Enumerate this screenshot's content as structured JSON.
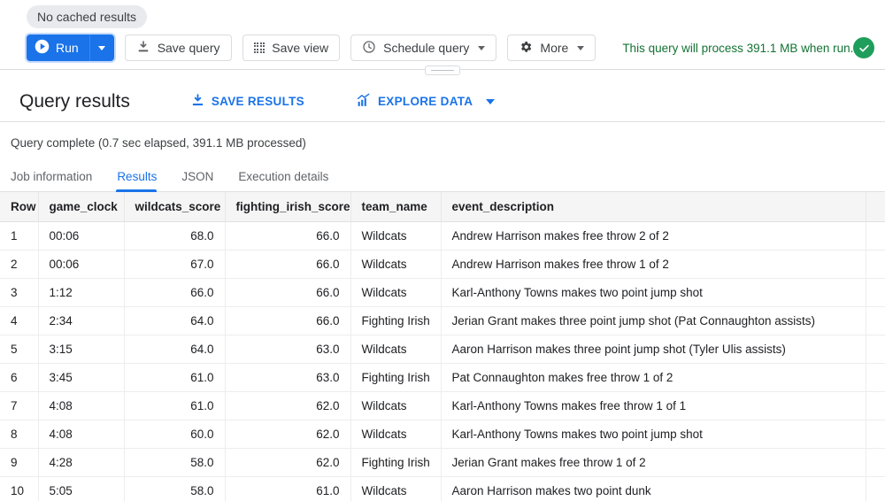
{
  "cache_chip": {
    "label": "No cached results"
  },
  "toolbar": {
    "run_label": "Run",
    "save_query_label": "Save query",
    "save_view_label": "Save view",
    "schedule_query_label": "Schedule query",
    "more_label": "More",
    "process_message": "This query will process 391.1 MB when run.",
    "valid_color": "#1e9e5a",
    "accent_color": "#1a73e8",
    "process_color": "#137333"
  },
  "results_header": {
    "title": "Query results",
    "save_results_label": "SAVE RESULTS",
    "explore_data_label": "EXPLORE DATA"
  },
  "status": {
    "text": "Query complete (0.7 sec elapsed, 391.1 MB processed)"
  },
  "tabs": [
    {
      "label": "Job information",
      "active": false
    },
    {
      "label": "Results",
      "active": true
    },
    {
      "label": "JSON",
      "active": false
    },
    {
      "label": "Execution details",
      "active": false
    }
  ],
  "table": {
    "columns": [
      "Row",
      "game_clock",
      "wildcats_score",
      "fighting_irish_score",
      "team_name",
      "event_description"
    ],
    "rows": [
      {
        "row": "1",
        "game_clock": "00:06",
        "wildcats_score": "68.0",
        "fighting_irish_score": "66.0",
        "team_name": "Wildcats",
        "event_description": "Andrew Harrison makes free throw 2 of 2"
      },
      {
        "row": "2",
        "game_clock": "00:06",
        "wildcats_score": "67.0",
        "fighting_irish_score": "66.0",
        "team_name": "Wildcats",
        "event_description": "Andrew Harrison makes free throw 1 of 2"
      },
      {
        "row": "3",
        "game_clock": "1:12",
        "wildcats_score": "66.0",
        "fighting_irish_score": "66.0",
        "team_name": "Wildcats",
        "event_description": "Karl-Anthony Towns makes two point jump shot"
      },
      {
        "row": "4",
        "game_clock": "2:34",
        "wildcats_score": "64.0",
        "fighting_irish_score": "66.0",
        "team_name": "Fighting Irish",
        "event_description": "Jerian Grant makes three point jump shot (Pat Connaughton assists)"
      },
      {
        "row": "5",
        "game_clock": "3:15",
        "wildcats_score": "64.0",
        "fighting_irish_score": "63.0",
        "team_name": "Wildcats",
        "event_description": "Aaron Harrison makes three point jump shot (Tyler Ulis assists)"
      },
      {
        "row": "6",
        "game_clock": "3:45",
        "wildcats_score": "61.0",
        "fighting_irish_score": "63.0",
        "team_name": "Fighting Irish",
        "event_description": "Pat Connaughton makes free throw 1 of 2"
      },
      {
        "row": "7",
        "game_clock": "4:08",
        "wildcats_score": "61.0",
        "fighting_irish_score": "62.0",
        "team_name": "Wildcats",
        "event_description": "Karl-Anthony Towns makes free throw 1 of 1"
      },
      {
        "row": "8",
        "game_clock": "4:08",
        "wildcats_score": "60.0",
        "fighting_irish_score": "62.0",
        "team_name": "Wildcats",
        "event_description": "Karl-Anthony Towns makes two point jump shot"
      },
      {
        "row": "9",
        "game_clock": "4:28",
        "wildcats_score": "58.0",
        "fighting_irish_score": "62.0",
        "team_name": "Fighting Irish",
        "event_description": "Jerian Grant makes free throw 1 of 2"
      },
      {
        "row": "10",
        "game_clock": "5:05",
        "wildcats_score": "58.0",
        "fighting_irish_score": "61.0",
        "team_name": "Wildcats",
        "event_description": "Aaron Harrison makes two point dunk"
      }
    ]
  }
}
